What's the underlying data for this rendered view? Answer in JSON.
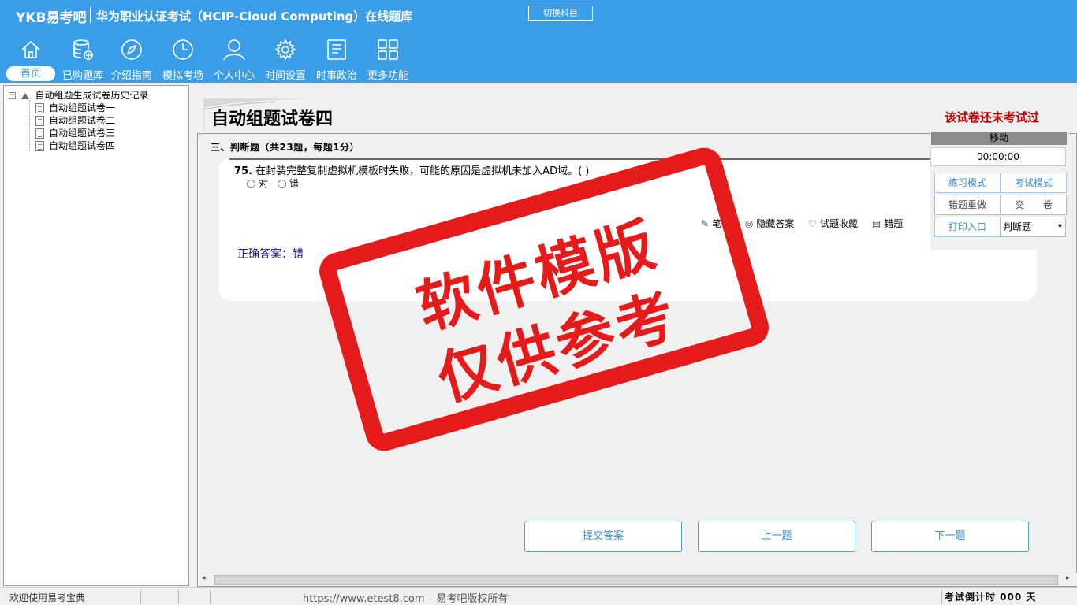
{
  "header": {
    "brand": "YKB易考吧",
    "title": "华为职业认证考试（HCIP-Cloud Computing）在线题库",
    "switch_label": "切换科目",
    "nav": [
      {
        "label": "首页",
        "icon": "home-icon"
      },
      {
        "label": "已购题库",
        "icon": "database-icon"
      },
      {
        "label": "介绍指南",
        "icon": "compass-icon"
      },
      {
        "label": "模拟考场",
        "icon": "clock-icon"
      },
      {
        "label": "个人中心",
        "icon": "user-icon"
      },
      {
        "label": "时间设置",
        "icon": "gear-icon"
      },
      {
        "label": "时事政治",
        "icon": "news-icon"
      },
      {
        "label": "更多功能",
        "icon": "grid-icon"
      }
    ]
  },
  "tree": {
    "root": "自动组题生成试卷历史记录",
    "items": [
      "自动组题试卷一",
      "自动组题试卷二",
      "自动组题试卷三",
      "自动组题试卷四"
    ]
  },
  "paper": {
    "title": "自动组题试卷四",
    "status": "该试卷还未考试过",
    "section": "三、判断题（共23题，每题1分）"
  },
  "question": {
    "number": "75.",
    "text": "在封装完整复制虚拟机模板时失败，可能的原因是虚拟机未加入AD域。( )",
    "options": [
      "对",
      "错"
    ],
    "tools": [
      "笔记",
      "隐藏答案",
      "试题收藏",
      "错题"
    ],
    "answer": "正确答案：错"
  },
  "actions": {
    "submit": "提交答案",
    "prev": "上一题",
    "next": "下一题"
  },
  "panel": {
    "move": "移动",
    "timer": "00:00:00",
    "practice": "练习模式",
    "exam": "考试模式",
    "redo": "错题重做",
    "hand_in": "交　　卷",
    "print": "打印入口",
    "type_select": "判断题"
  },
  "watermark": {
    "line1": "软件模版",
    "line2": "仅供参考"
  },
  "status": {
    "welcome": "欢迎使用易考宝典",
    "copyright": "https://www.etest8.com – 易考吧版权所有",
    "countdown": "考试倒计时 000 天"
  }
}
